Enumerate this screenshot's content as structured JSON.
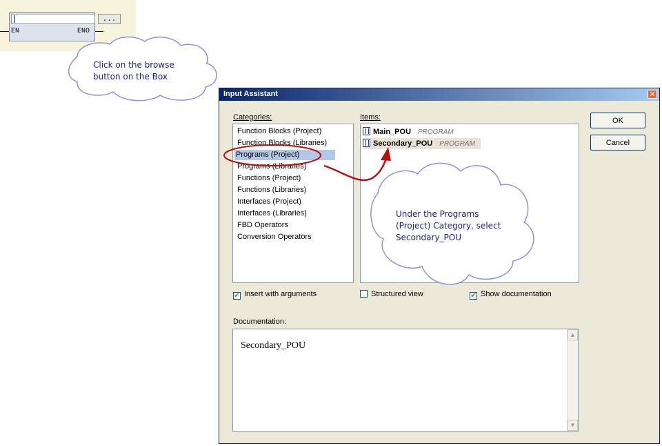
{
  "fbd": {
    "en_label": "EN",
    "eno_label": "ENO",
    "browse_label": "..."
  },
  "callout1": {
    "text": "Click on the browse\nbutton on the Box"
  },
  "callout2": {
    "text": "Under the Programs\n(Project) Category, select\nSecondary_POU"
  },
  "dialog": {
    "title": "Input Assistant",
    "close_glyph": "✕",
    "categories_label": "Categories:",
    "items_label": "Items:",
    "categories": [
      "Function Blocks (Project)",
      "Function Blocks (Libraries)",
      "Programs (Project)",
      "Programs (Libraries)",
      "Functions (Project)",
      "Functions (Libraries)",
      "Interfaces (Project)",
      "Interfaces (Libraries)",
      "FBD Operators",
      "Conversion Operators"
    ],
    "selected_category": "Programs (Project)",
    "items": [
      {
        "name": "Main_POU",
        "type": "PROGRAM",
        "icon": "program-icon"
      },
      {
        "name": "Secondary_POU",
        "type": "PROGRAM",
        "icon": "program-icon"
      }
    ],
    "ok_label": "OK",
    "cancel_label": "Cancel",
    "insert_with_arguments": {
      "label": "Insert with arguments",
      "checked": true
    },
    "structured_view": {
      "label": "Structured view",
      "checked": false
    },
    "show_documentation": {
      "label": "Show documentation",
      "checked": true
    },
    "check_glyph": "✔",
    "documentation_label": "Documentation:",
    "documentation_text": "Secondary_POU",
    "scroll_up_glyph": "▲",
    "scroll_down_glyph": "▼"
  },
  "colors": {
    "callout_outline": "#8f8fe8",
    "annotation_red": "#b80f0f",
    "selection": "#b3c8e6",
    "title_start": "#0a246a",
    "title_end": "#a6caf0"
  }
}
